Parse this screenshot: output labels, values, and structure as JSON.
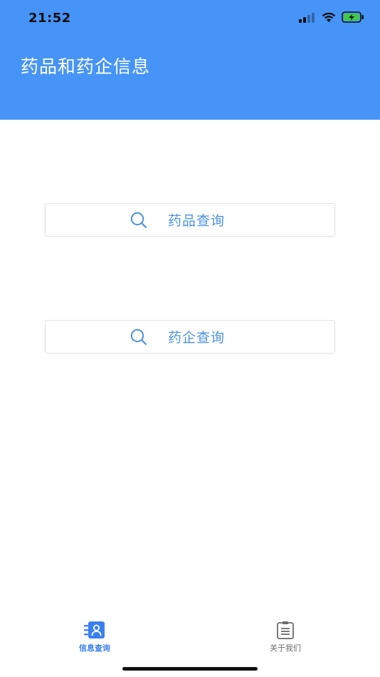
{
  "status_bar": {
    "time": "21:52",
    "icons": [
      "signal-icon",
      "wifi-icon",
      "battery-charging-icon"
    ]
  },
  "header": {
    "title": "药品和药企信息"
  },
  "main": {
    "buttons": [
      {
        "label": "药品查询",
        "icon": "search-icon"
      },
      {
        "label": "药企查询",
        "icon": "search-icon"
      }
    ]
  },
  "tabbar": {
    "tabs": [
      {
        "label": "信息查询",
        "icon": "contacts-book-icon",
        "active": true
      },
      {
        "label": "关于我们",
        "icon": "clipboard-icon",
        "active": false
      }
    ]
  },
  "colors": {
    "header_bg": "#4694f7",
    "accent": "#4a93e3",
    "active_tab": "#3a7ff0",
    "inactive_tab": "#6b6b6b",
    "battery_green": "#3fc84a"
  }
}
